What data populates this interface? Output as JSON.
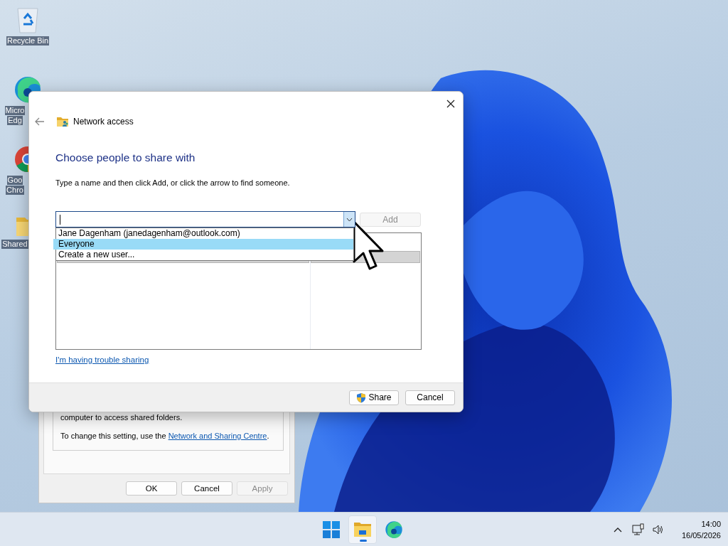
{
  "desktop_icons": [
    {
      "kind": "recycle",
      "label_lines": [
        "Recycle Bin"
      ]
    },
    {
      "kind": "edge",
      "label_lines": [
        "Micro",
        "Edg"
      ]
    },
    {
      "kind": "chrome",
      "label_lines": [
        "Goo",
        "Chro"
      ]
    },
    {
      "kind": "folder",
      "label_lines": [
        "Shared"
      ]
    }
  ],
  "background_window": {
    "text_lines": [
      "computer to access shared folders."
    ],
    "setting_text": "To change this setting, use the ",
    "setting_link": "Network and Sharing Centre",
    "setting_end": ".",
    "buttons": [
      {
        "label": "OK",
        "disabled": false
      },
      {
        "label": "Cancel",
        "disabled": false
      },
      {
        "label": "Apply",
        "disabled": true
      }
    ]
  },
  "dialog": {
    "title": "Network access",
    "heading": "Choose people to share with",
    "instruction": "Type a name and then click Add, or click the arrow to find someone.",
    "dropdown": {
      "expanded": true,
      "options": [
        {
          "label": "Jane Dagenham (janedagenham@outlook.com)",
          "selected": false
        },
        {
          "label": "Everyone",
          "selected": true
        },
        {
          "label": "Create a new user...",
          "selected": false
        }
      ]
    },
    "add_button": {
      "label": "Add",
      "disabled": true
    },
    "link": "I'm having trouble sharing",
    "buttons": [
      {
        "label": "Share",
        "kind": "shield"
      },
      {
        "label": "Cancel",
        "kind": "plain"
      }
    ]
  },
  "taskbar": {
    "apps": [
      {
        "kind": "start",
        "active": false
      },
      {
        "kind": "explorer",
        "active": true
      },
      {
        "kind": "edge",
        "active": false
      }
    ],
    "time": "14:00",
    "date": "16/05/2026"
  }
}
